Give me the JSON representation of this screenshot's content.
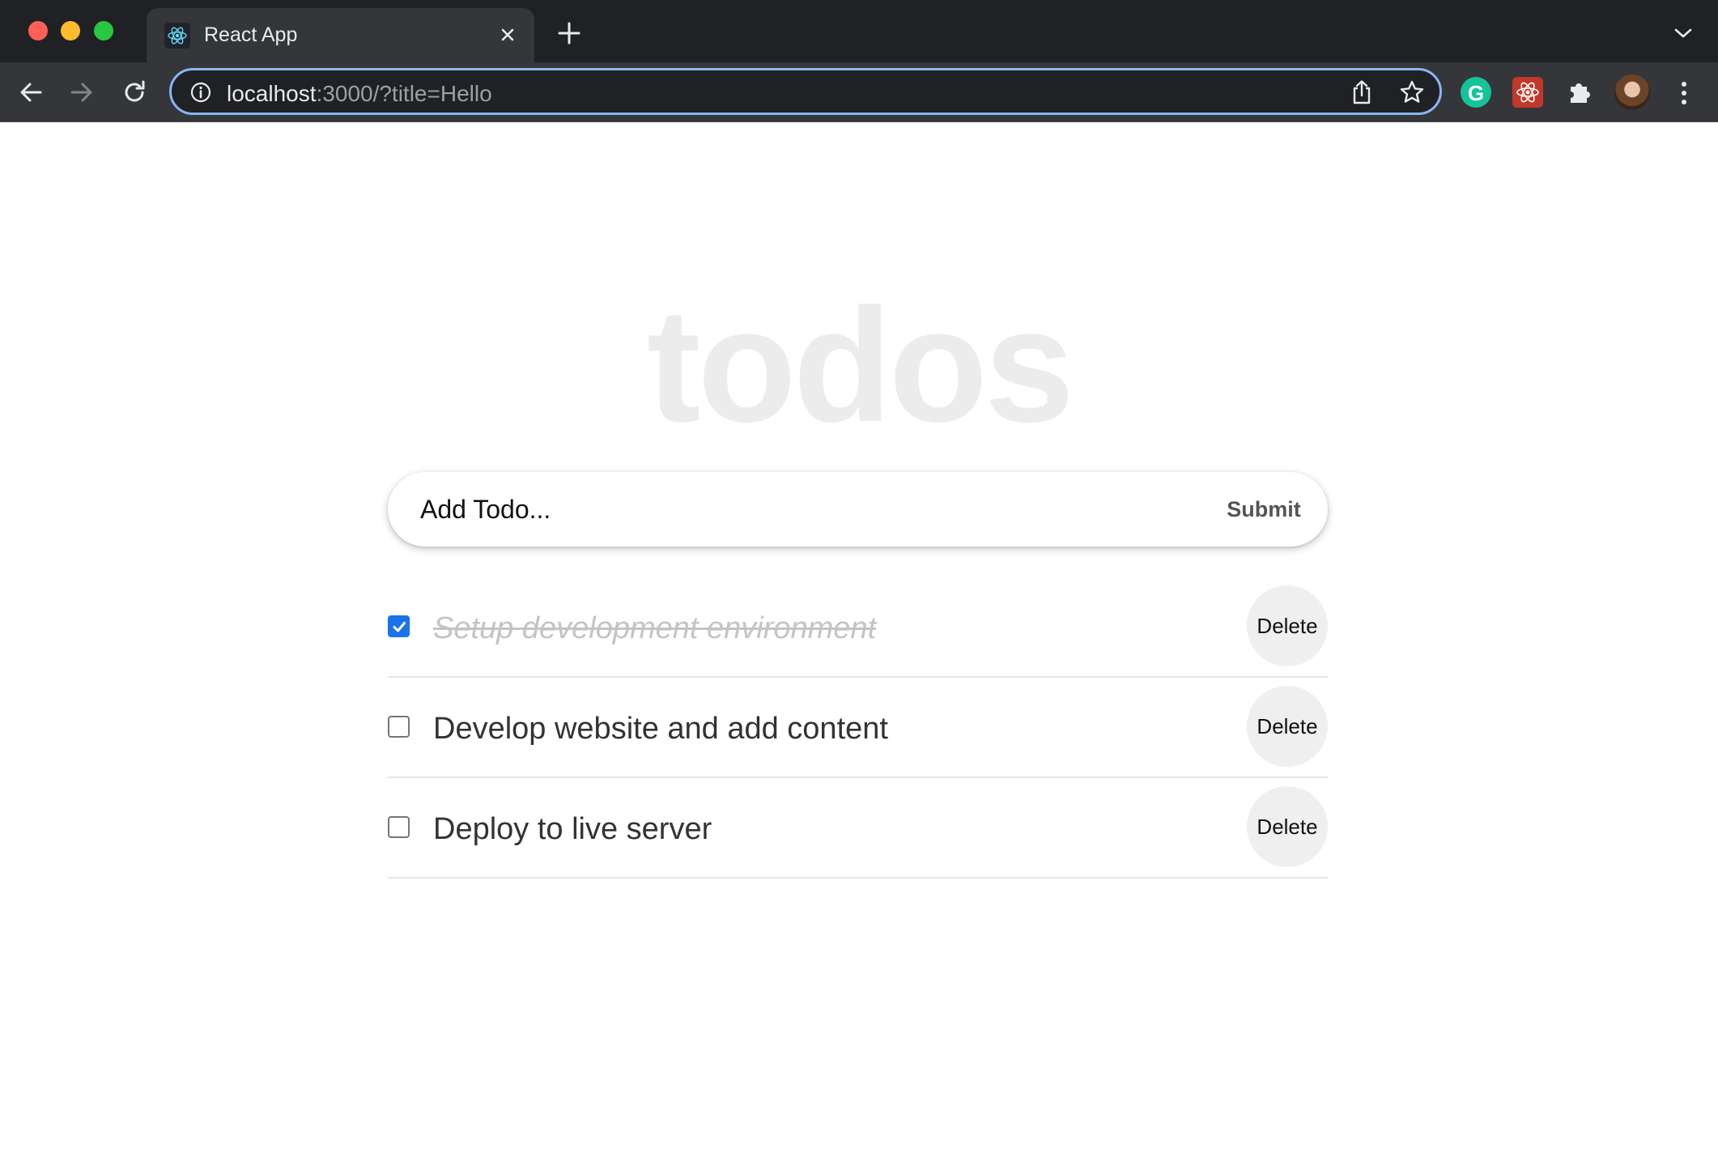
{
  "browser": {
    "tab": {
      "title": "React App",
      "favicon": "react-icon"
    },
    "url": {
      "host": "localhost",
      "rest": ":3000/?title=Hello"
    },
    "extensions": [
      {
        "name": "grammarly-icon",
        "letter": "G"
      },
      {
        "name": "react-devtools-icon"
      },
      {
        "name": "extensions-puzzle-icon"
      }
    ]
  },
  "app": {
    "heading": "todos",
    "form": {
      "placeholder": "Add Todo...",
      "submit_label": "Submit"
    },
    "todos": [
      {
        "text": "Setup development environment",
        "completed": true,
        "delete_label": "Delete"
      },
      {
        "text": "Develop website and add content",
        "completed": false,
        "delete_label": "Delete"
      },
      {
        "text": "Deploy to live server",
        "completed": false,
        "delete_label": "Delete"
      }
    ]
  },
  "colors": {
    "accent": "#1a73e8",
    "omnibox_focus": "#8ab4f8",
    "heading": "#ececec"
  }
}
